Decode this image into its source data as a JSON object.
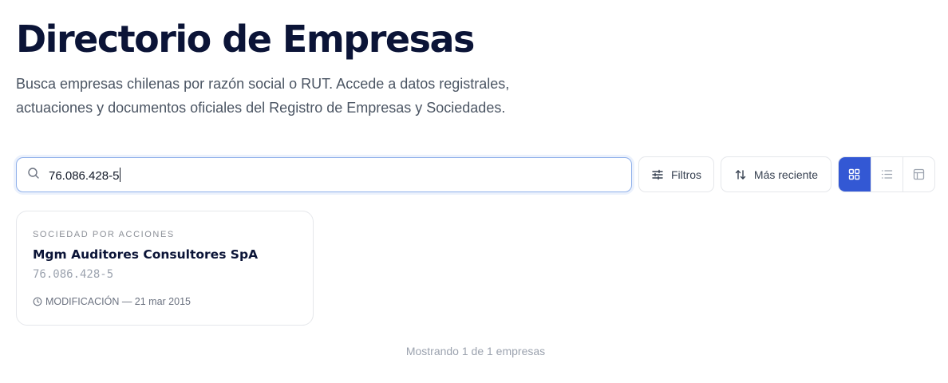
{
  "header": {
    "title": "Directorio de Empresas",
    "description": "Busca empresas chilenas por razón social o RUT. Accede a datos registrales, actuaciones y documentos oficiales del Registro de Empresas y Sociedades."
  },
  "search": {
    "value": "76.086.428-5",
    "icon": "search-icon"
  },
  "toolbar": {
    "filters_label": "Filtros",
    "filters_icon": "sliders-icon",
    "sort_label": "Más reciente",
    "sort_icon": "sort-arrows-icon",
    "views": [
      {
        "name": "grid",
        "icon": "grid-view-icon",
        "active": true
      },
      {
        "name": "list",
        "icon": "list-view-icon",
        "active": false
      },
      {
        "name": "table",
        "icon": "table-view-icon",
        "active": false
      }
    ],
    "accent_color": "#3358d4"
  },
  "results": [
    {
      "type": "SOCIEDAD POR ACCIONES",
      "name": "Mgm Auditores Consultores SpA",
      "rut": "76.086.428-5",
      "meta": "MODIFICACIÓN — 21 mar 2015",
      "meta_icon": "clock-icon"
    }
  ],
  "footer": {
    "count_text": "Mostrando 1 de 1 empresas"
  }
}
